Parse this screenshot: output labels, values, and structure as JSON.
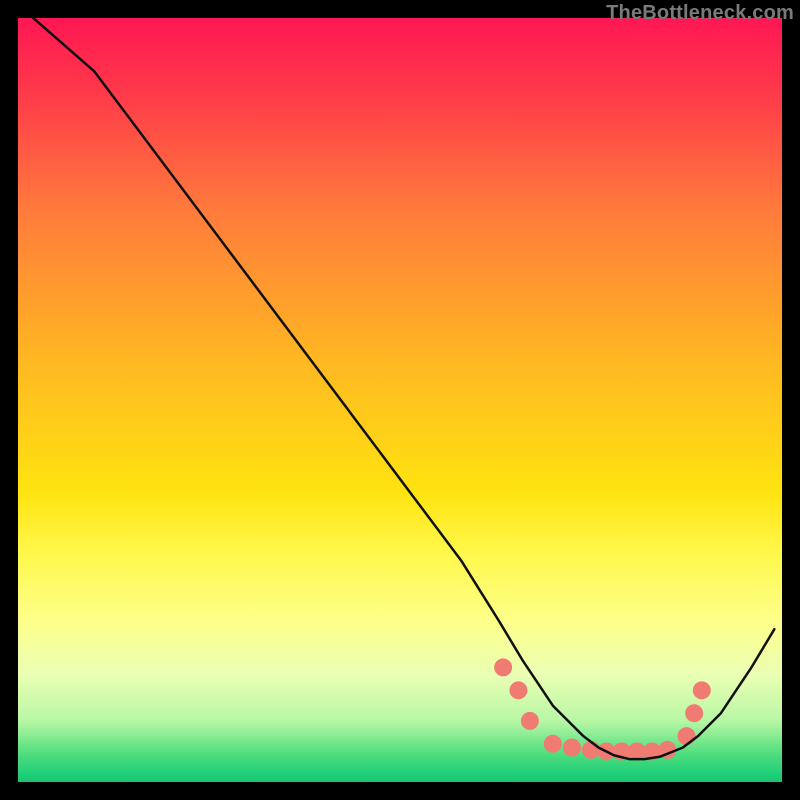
{
  "watermark": "TheBottleneck.com",
  "chart_data": {
    "type": "line",
    "title": "",
    "xlabel": "",
    "ylabel": "",
    "xlim": [
      0,
      100
    ],
    "ylim": [
      0,
      100
    ],
    "series": [
      {
        "name": "curve",
        "x": [
          2,
          10,
          16,
          22,
          28,
          34,
          40,
          46,
          52,
          58,
          63,
          66,
          68,
          70,
          72,
          74,
          76,
          78,
          80,
          82,
          84,
          85,
          87,
          89,
          92,
          96,
          99
        ],
        "y": [
          100,
          93,
          85,
          77,
          69,
          61,
          53,
          45,
          37,
          29,
          21,
          16,
          13,
          10,
          8,
          6,
          4.5,
          3.5,
          3,
          3,
          3.3,
          3.7,
          4.5,
          6,
          9,
          15,
          20
        ]
      }
    ],
    "dots": {
      "name": "dots",
      "x": [
        63.5,
        65.5,
        67,
        70,
        72.5,
        75,
        77,
        79,
        81,
        83,
        85,
        87.5,
        88.5,
        89.5
      ],
      "y": [
        15,
        12,
        8,
        5,
        4.5,
        4.2,
        4,
        4,
        4,
        4,
        4.2,
        6,
        9,
        12
      ]
    },
    "plot_inset": {
      "left": 18,
      "right": 18,
      "top": 18,
      "bottom": 18
    },
    "gradient_stops": [
      {
        "offset": 0.0,
        "color": "#ff1753"
      },
      {
        "offset": 0.1,
        "color": "#ff3a4a"
      },
      {
        "offset": 0.25,
        "color": "#ff7a3c"
      },
      {
        "offset": 0.45,
        "color": "#ffb822"
      },
      {
        "offset": 0.62,
        "color": "#ffe310"
      },
      {
        "offset": 0.7,
        "color": "#fff84b"
      },
      {
        "offset": 0.79,
        "color": "#fdff8a"
      },
      {
        "offset": 0.86,
        "color": "#eaffb4"
      },
      {
        "offset": 0.92,
        "color": "#b8f7a4"
      },
      {
        "offset": 0.965,
        "color": "#4cdc7d"
      },
      {
        "offset": 0.99,
        "color": "#1ecf78"
      },
      {
        "offset": 1.0,
        "color": "#19c474"
      }
    ],
    "style": {
      "line_color": "#111111",
      "line_width": 2.5,
      "dot_color": "#ef7b73",
      "dot_radius": 9
    }
  }
}
